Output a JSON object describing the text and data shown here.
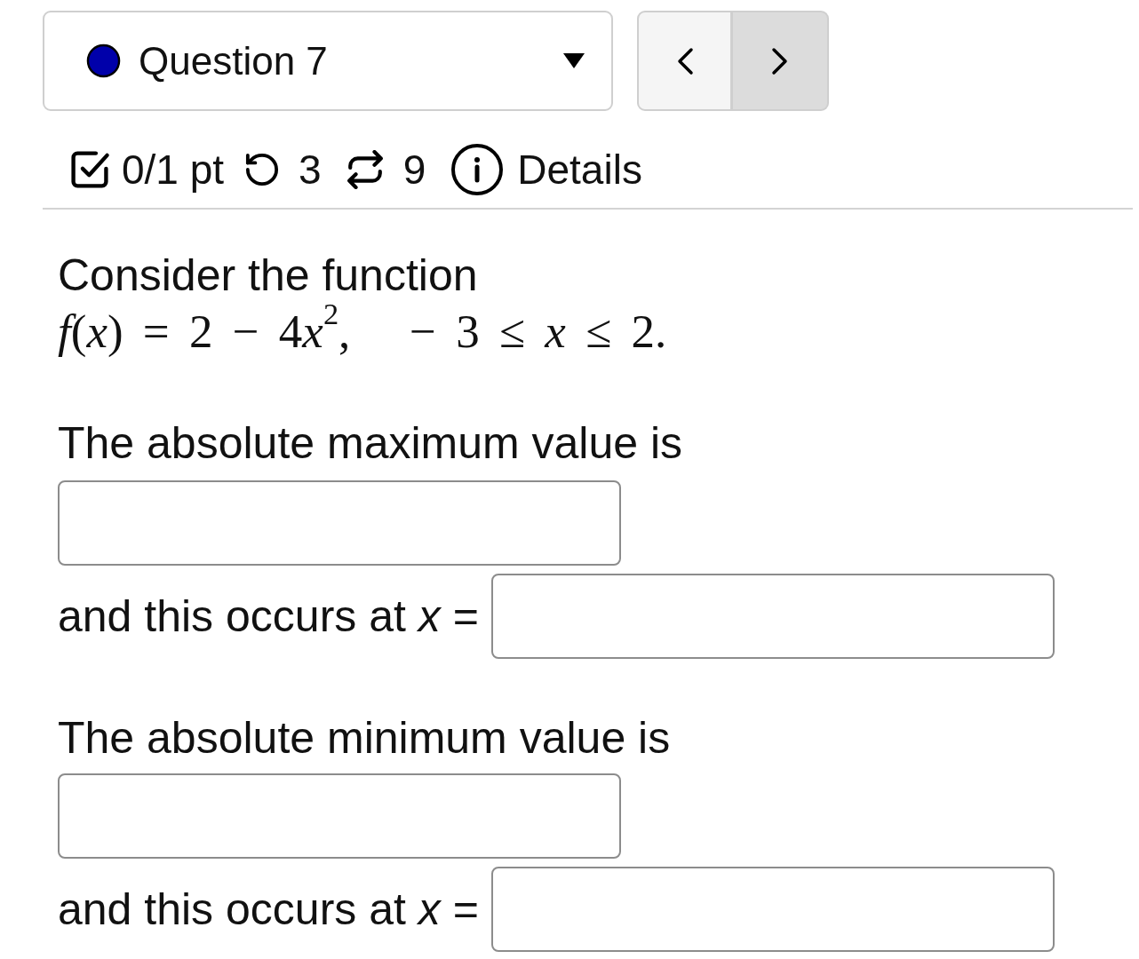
{
  "question_selector": {
    "label": "Question 7",
    "color": "#0000aa"
  },
  "meta": {
    "score": "0/1 pt",
    "retries": "3",
    "attempts": "9",
    "details": "Details"
  },
  "question": {
    "intro": "Consider the function",
    "formula": "f(x) = 2 − 4x$^{2}$,   − 3 ≤ x ≤ 2."
  },
  "parts": [
    {
      "kind": "value",
      "label": "The absolute maximum value is"
    },
    {
      "kind": "location",
      "label": "and this occurs at *x* ="
    },
    {
      "kind": "value",
      "label": "The absolute minimum value is"
    },
    {
      "kind": "location",
      "label": "and this occurs at *x* ="
    }
  ]
}
